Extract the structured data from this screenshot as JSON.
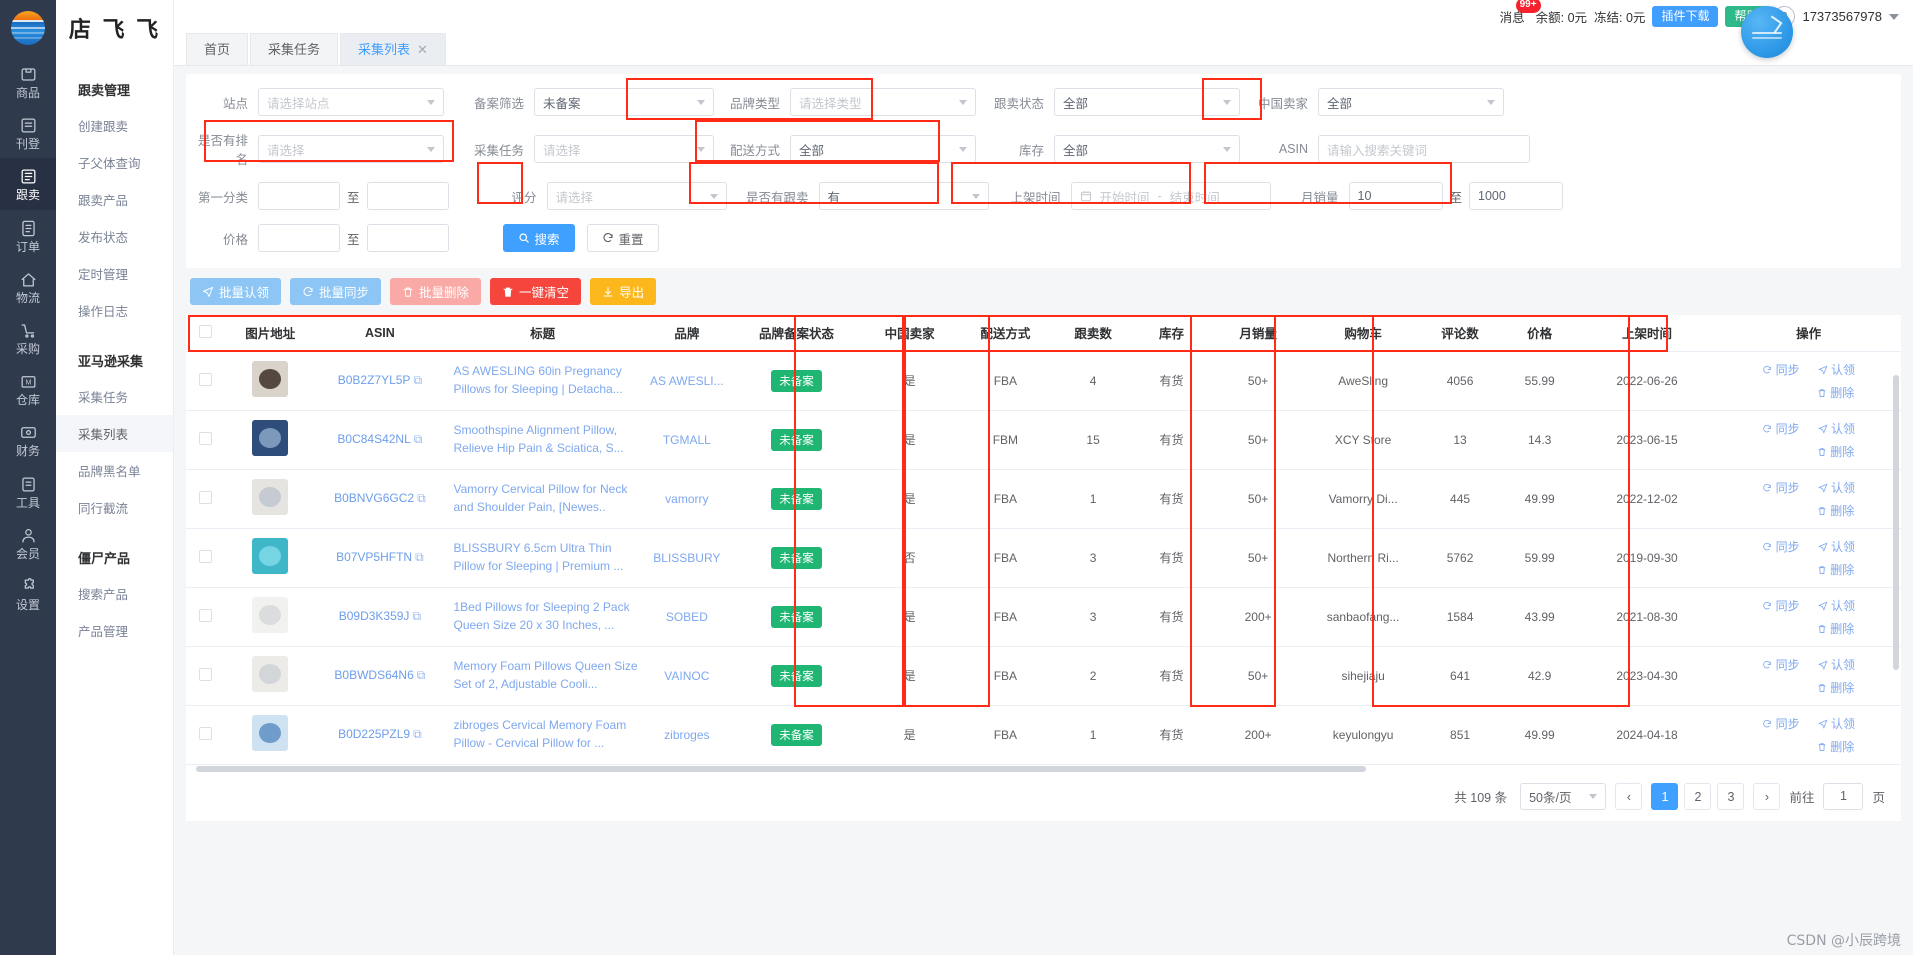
{
  "brand": {
    "logo_text": "店 飞 飞",
    "logo_icon": "globe-icon"
  },
  "rail": {
    "items": [
      {
        "label": "商品",
        "icon": "box-icon",
        "active": false
      },
      {
        "label": "刊登",
        "icon": "doc-icon",
        "active": false
      },
      {
        "label": "跟卖",
        "icon": "copy-doc-icon",
        "active": true
      },
      {
        "label": "订单",
        "icon": "list-icon",
        "active": false
      },
      {
        "label": "物流",
        "icon": "truck-icon",
        "active": false
      },
      {
        "label": "采购",
        "icon": "cart-icon",
        "active": false
      },
      {
        "label": "仓库",
        "icon": "warehouse-icon",
        "active": false
      },
      {
        "label": "财务",
        "icon": "money-icon",
        "active": false
      },
      {
        "label": "工具",
        "icon": "tools-icon",
        "active": false
      },
      {
        "label": "会员",
        "icon": "user-icon",
        "active": false
      },
      {
        "label": "设置",
        "icon": "puzzle-icon",
        "active": false
      }
    ]
  },
  "subnav": {
    "groups": [
      {
        "title": "跟卖管理",
        "links": [
          "创建跟卖",
          "子父体查询",
          "跟卖产品",
          "发布状态",
          "定时管理",
          "操作日志"
        ]
      },
      {
        "title": "亚马逊采集",
        "links": [
          "采集任务",
          "采集列表",
          "品牌黑名单",
          "同行截流"
        ],
        "active_link": "采集列表"
      },
      {
        "title": "僵尸产品",
        "links": [
          "搜索产品",
          "产品管理"
        ]
      }
    ]
  },
  "topbar": {
    "message_label": "消息",
    "message_badge": "99+",
    "balance": "余额: 0元",
    "frozen": "冻结: 0元",
    "plugin_button": "插件下载",
    "help_button": "帮助",
    "account": "17373567978"
  },
  "tabs": [
    {
      "label": "首页",
      "closable": false,
      "active": false
    },
    {
      "label": "采集任务",
      "closable": false,
      "active": false
    },
    {
      "label": "采集列表",
      "closable": true,
      "active": true
    }
  ],
  "filters": {
    "row1": [
      {
        "label": "站点",
        "value": "",
        "placeholder": "请选择站点",
        "type": "select",
        "highlight": false
      },
      {
        "label": "备案筛选",
        "value": "未备案",
        "placeholder": "",
        "type": "select",
        "highlight": true
      },
      {
        "label": "品牌类型",
        "value": "",
        "placeholder": "请选择类型",
        "type": "select",
        "highlight": false
      },
      {
        "label": "跟卖状态",
        "value": "全部",
        "placeholder": "",
        "type": "select",
        "highlight": false
      },
      {
        "label": "中国卖家",
        "value": "全部",
        "placeholder": "",
        "type": "select",
        "highlight": true
      }
    ],
    "row2": [
      {
        "label": "是否有排名",
        "value": "",
        "placeholder": "请选择",
        "type": "select",
        "highlight": true
      },
      {
        "label": "采集任务",
        "value": "",
        "placeholder": "请选择",
        "type": "select",
        "highlight": false
      },
      {
        "label": "配送方式",
        "value": "全部",
        "placeholder": "",
        "type": "select",
        "highlight": true
      },
      {
        "label": "库存",
        "value": "全部",
        "placeholder": "",
        "type": "select",
        "highlight": false
      },
      {
        "label": "ASIN",
        "value": "",
        "placeholder": "请输入搜索关键词",
        "type": "input",
        "highlight": false
      }
    ],
    "row3": {
      "first_category_label": "第一分类",
      "first_category_from": "",
      "first_category_to": "",
      "between_label": "至",
      "rating_label": "评分",
      "rating_value": "",
      "rating_placeholder": "请选择",
      "has_follow_label": "是否有跟卖",
      "has_follow_value": "有",
      "listed_time_label": "上架时间",
      "listed_time_start_placeholder": "开始时间",
      "listed_time_dash": "-",
      "listed_time_end_placeholder": "结束时间",
      "monthly_sales_label": "月销量",
      "monthly_sales_from": "10",
      "monthly_sales_to": "1000"
    },
    "row4": {
      "price_label": "价格",
      "price_from": "",
      "price_to": "",
      "between_label": "至",
      "search_button": "搜索",
      "reset_button": "重置"
    }
  },
  "actions": [
    {
      "label": "批量认领",
      "icon": "send-icon",
      "style": "lightblue"
    },
    {
      "label": "批量同步",
      "icon": "refresh-icon",
      "style": "lightblue"
    },
    {
      "label": "批量删除",
      "icon": "trash-icon",
      "style": "pink"
    },
    {
      "label": "一键清空",
      "icon": "trash-solid-icon",
      "style": "red"
    },
    {
      "label": "导出",
      "icon": "download-icon",
      "style": "orange"
    }
  ],
  "table": {
    "columns": [
      {
        "key": "check",
        "label": "",
        "highlight": false
      },
      {
        "key": "image",
        "label": "图片地址",
        "highlight": false
      },
      {
        "key": "asin",
        "label": "ASIN",
        "highlight": false
      },
      {
        "key": "title",
        "label": "标题",
        "highlight": false
      },
      {
        "key": "brand",
        "label": "品牌",
        "highlight": false
      },
      {
        "key": "record_status",
        "label": "品牌备案状态",
        "highlight": true
      },
      {
        "key": "cn_seller",
        "label": "中国卖家",
        "highlight": true
      },
      {
        "key": "ship_method",
        "label": "配送方式",
        "highlight": false
      },
      {
        "key": "follow_count",
        "label": "跟卖数",
        "highlight": false
      },
      {
        "key": "stock",
        "label": "库存",
        "highlight": false
      },
      {
        "key": "monthly_sales",
        "label": "月销量",
        "highlight": true
      },
      {
        "key": "cart",
        "label": "购物车",
        "highlight": false
      },
      {
        "key": "reviews",
        "label": "评论数",
        "highlight": true
      },
      {
        "key": "price",
        "label": "价格",
        "highlight": true
      },
      {
        "key": "listed_date",
        "label": "上架时间",
        "highlight": true
      },
      {
        "key": "ops",
        "label": "操作",
        "highlight": false
      }
    ],
    "row_ops": [
      {
        "label": "同步",
        "icon": "sync-icon"
      },
      {
        "label": "认领",
        "icon": "claim-icon"
      },
      {
        "label": "删除",
        "icon": "delete-icon"
      }
    ],
    "rows": [
      {
        "asin": "B0B2Z7YL5P",
        "title": "AS AWESLING 60in Pregnancy Pillows for Sleeping | Detacha...",
        "brand": "AS AWESLI...",
        "record_status": "未备案",
        "cn_seller": "是",
        "ship_method": "FBA",
        "follow_count": "4",
        "stock": "有货",
        "monthly_sales": "50+",
        "cart": "AweSling",
        "reviews": "4056",
        "price": "55.99",
        "listed_date": "2022-06-26"
      },
      {
        "asin": "B0C84S42NL",
        "title": "Smoothspine Alignment Pillow, Relieve Hip Pain & Sciatica, S...",
        "brand": "TGMALL",
        "record_status": "未备案",
        "cn_seller": "是",
        "ship_method": "FBM",
        "follow_count": "15",
        "stock": "有货",
        "monthly_sales": "50+",
        "cart": "XCY Store",
        "reviews": "13",
        "price": "14.3",
        "listed_date": "2023-06-15"
      },
      {
        "asin": "B0BNVG6GC2",
        "title": "Vamorry Cervical Pillow for Neck and Shoulder Pain, [Newes..",
        "brand": "vamorry",
        "record_status": "未备案",
        "cn_seller": "是",
        "ship_method": "FBA",
        "follow_count": "1",
        "stock": "有货",
        "monthly_sales": "50+",
        "cart": "Vamorry Di...",
        "reviews": "445",
        "price": "49.99",
        "listed_date": "2022-12-02"
      },
      {
        "asin": "B07VP5HFTN",
        "title": "BLISSBURY 6.5cm Ultra Thin Pillow for Sleeping | Premium ...",
        "brand": "BLISSBURY",
        "record_status": "未备案",
        "cn_seller": "否",
        "ship_method": "FBA",
        "follow_count": "3",
        "stock": "有货",
        "monthly_sales": "50+",
        "cart": "Northern Ri...",
        "reviews": "5762",
        "price": "59.99",
        "listed_date": "2019-09-30"
      },
      {
        "asin": "B09D3K359J",
        "title": "1Bed Pillows for Sleeping 2 Pack Queen Size 20 x 30 Inches, ...",
        "brand": "SOBED",
        "record_status": "未备案",
        "cn_seller": "是",
        "ship_method": "FBA",
        "follow_count": "3",
        "stock": "有货",
        "monthly_sales": "200+",
        "cart": "sanbaofang...",
        "reviews": "1584",
        "price": "43.99",
        "listed_date": "2021-08-30"
      },
      {
        "asin": "B0BWDS64N6",
        "title": "Memory Foam Pillows Queen Size Set of 2, Adjustable Cooli...",
        "brand": "VAINOC",
        "record_status": "未备案",
        "cn_seller": "是",
        "ship_method": "FBA",
        "follow_count": "2",
        "stock": "有货",
        "monthly_sales": "50+",
        "cart": "sihejiaju",
        "reviews": "641",
        "price": "42.9",
        "listed_date": "2023-04-30"
      },
      {
        "asin": "B0D225PZL9",
        "title": "zibroges Cervical Memory Foam Pillow - Cervical Pillow for ...",
        "brand": "zibroges",
        "record_status": "未备案",
        "cn_seller": "是",
        "ship_method": "FBA",
        "follow_count": "1",
        "stock": "有货",
        "monthly_sales": "200+",
        "cart": "keyulongyu",
        "reviews": "851",
        "price": "49.99",
        "listed_date": "2024-04-18"
      }
    ]
  },
  "pagination": {
    "total_text": "共 109 条",
    "page_size": "50条/页",
    "prev": "‹",
    "next": "›",
    "pages": [
      "1",
      "2",
      "3"
    ],
    "current_page": "1",
    "jump_prefix": "前往",
    "jump_value": "1",
    "jump_suffix": "页"
  },
  "watermark": "CSDN @小辰跨境",
  "colors": {
    "accent": "#409eff",
    "highlight": "#ff2b17",
    "green_tag": "#1fb673",
    "danger": "#f5453c",
    "warning": "#fcb71c"
  }
}
